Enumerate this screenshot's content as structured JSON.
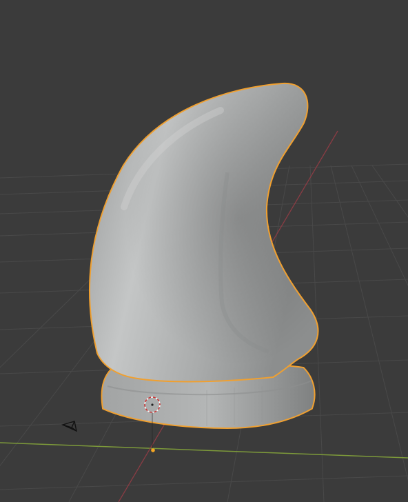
{
  "app": {
    "name": "",
    "editor": "3D Viewport"
  },
  "viewport": {
    "background_color": "#3b3b3b",
    "grid_color": "#494949",
    "x_axis_color": "#7d9a3a",
    "y_axis_color": "#8a3c44",
    "selection_outline_color": "#f0a030"
  },
  "scene": {
    "selected_object": {
      "kind": "sculpted-mesh",
      "shape": "horn",
      "selected": true,
      "surface_color": "#b9bbbb"
    },
    "origin_marker": {
      "color": "#f5a623"
    },
    "cursor_3d": {
      "style": "dashed-ring"
    },
    "camera_object": {
      "icon": "camera-icon"
    }
  }
}
